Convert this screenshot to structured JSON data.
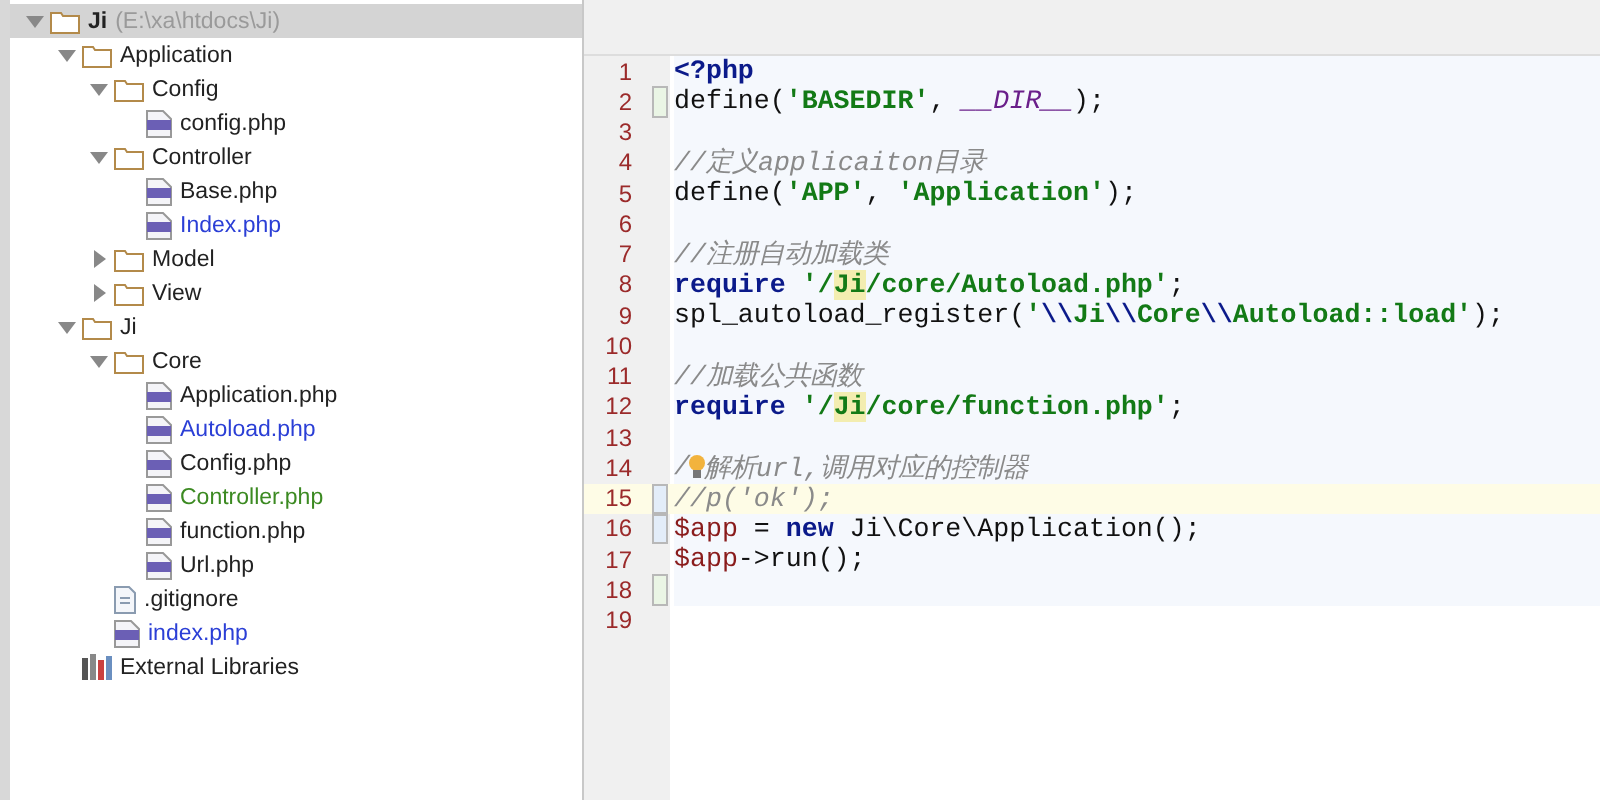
{
  "project_tree": {
    "root": {
      "name": "Ji",
      "path": "(E:\\xa\\htdocs\\Ji)",
      "selected": true,
      "expanded": true
    },
    "items": [
      {
        "kind": "folder",
        "name": "Application",
        "expanded": true,
        "children": [
          {
            "kind": "folder",
            "name": "Config",
            "expanded": true,
            "children": [
              {
                "kind": "php",
                "name": "config.php"
              }
            ]
          },
          {
            "kind": "folder",
            "name": "Controller",
            "expanded": true,
            "children": [
              {
                "kind": "php",
                "name": "Base.php"
              },
              {
                "kind": "php",
                "name": "Index.php",
                "color": "#2b3fd6"
              }
            ]
          },
          {
            "kind": "folder",
            "name": "Model",
            "expanded": false
          },
          {
            "kind": "folder",
            "name": "View",
            "expanded": false
          }
        ]
      },
      {
        "kind": "folder",
        "name": "Ji",
        "expanded": true,
        "children": [
          {
            "kind": "folder",
            "name": "Core",
            "expanded": true,
            "children": [
              {
                "kind": "php",
                "name": "Application.php"
              },
              {
                "kind": "php",
                "name": "Autoload.php",
                "color": "#2b3fd6"
              },
              {
                "kind": "php",
                "name": "Config.php"
              },
              {
                "kind": "php",
                "name": "Controller.php",
                "color": "#3c8a22"
              },
              {
                "kind": "php",
                "name": "function.php"
              },
              {
                "kind": "php",
                "name": "Url.php"
              }
            ]
          },
          {
            "kind": "text",
            "name": ".gitignore"
          },
          {
            "kind": "php",
            "name": "index.php",
            "color": "#2b3fd6"
          }
        ]
      },
      {
        "kind": "library",
        "name": "External Libraries"
      }
    ]
  },
  "editor": {
    "lines": [
      {
        "number": "1",
        "tokens": [
          {
            "kind": "keyword",
            "text": "<?php"
          }
        ]
      },
      {
        "number": "2",
        "kind": "added",
        "tokens": [
          {
            "kind": "plain",
            "text": "define("
          },
          {
            "kind": "string",
            "text": "'BASEDIR'"
          },
          {
            "kind": "plain",
            "text": ", "
          },
          {
            "kind": "constant",
            "text": "__DIR__"
          },
          {
            "kind": "plain",
            "text": ");"
          }
        ]
      },
      {
        "number": "3"
      },
      {
        "number": "4",
        "tokens": [
          {
            "kind": "comment",
            "text": "//定义applicaiton目录"
          }
        ]
      },
      {
        "number": "5",
        "tokens": [
          {
            "kind": "plain",
            "text": "define("
          },
          {
            "kind": "string",
            "text": "'APP'"
          },
          {
            "kind": "plain",
            "text": ", "
          },
          {
            "kind": "string",
            "text": "'Application'"
          },
          {
            "kind": "plain",
            "text": ");"
          }
        ]
      },
      {
        "number": "6"
      },
      {
        "number": "7",
        "tokens": [
          {
            "kind": "comment",
            "text": "//注册自动加载类"
          }
        ]
      },
      {
        "number": "8",
        "tokens": [
          {
            "kind": "keyword",
            "text": "require "
          },
          {
            "kind": "string",
            "text": "'/"
          },
          {
            "kind": "highlight",
            "text": "Ji"
          },
          {
            "kind": "string",
            "text": "/core/Autoload.php'"
          },
          {
            "kind": "plain",
            "text": ";"
          }
        ]
      },
      {
        "number": "9",
        "tokens": [
          {
            "kind": "plain",
            "text": "spl_autoload_register("
          },
          {
            "kind": "string",
            "text": "'"
          },
          {
            "kind": "escape",
            "text": "\\\\"
          },
          {
            "kind": "string",
            "text": "Ji"
          },
          {
            "kind": "escape",
            "text": "\\\\"
          },
          {
            "kind": "string",
            "text": "Core"
          },
          {
            "kind": "escape",
            "text": "\\\\"
          },
          {
            "kind": "string",
            "text": "Autoload::load'"
          },
          {
            "kind": "plain",
            "text": ");"
          }
        ]
      },
      {
        "number": "10"
      },
      {
        "number": "11",
        "tokens": [
          {
            "kind": "comment",
            "text": "//加载公共函数"
          }
        ]
      },
      {
        "number": "12",
        "tokens": [
          {
            "kind": "keyword",
            "text": "require "
          },
          {
            "kind": "string",
            "text": "'/"
          },
          {
            "kind": "highlight",
            "text": "Ji"
          },
          {
            "kind": "string",
            "text": "/core/function.php'"
          },
          {
            "kind": "plain",
            "text": ";"
          }
        ]
      },
      {
        "number": "13"
      },
      {
        "number": "14",
        "bulb": true,
        "tokens": [
          {
            "kind": "comment",
            "text": "/"
          },
          {
            "kind": "comment",
            "text": "解析url,调用对应的控制器"
          }
        ]
      },
      {
        "number": "15",
        "current": true,
        "kind": "modified",
        "tokens": [
          {
            "kind": "comment",
            "text": "//p('ok');"
          }
        ]
      },
      {
        "number": "16",
        "kind": "modified",
        "tokens": [
          {
            "kind": "variable",
            "text": "$app"
          },
          {
            "kind": "plain",
            "text": " = "
          },
          {
            "kind": "keyword",
            "text": "new"
          },
          {
            "kind": "plain",
            "text": " Ji\\Core\\Application();"
          }
        ]
      },
      {
        "number": "17",
        "tokens": [
          {
            "kind": "variable",
            "text": "$app"
          },
          {
            "kind": "plain",
            "text": "->run();"
          }
        ]
      },
      {
        "number": "18",
        "kind": "added"
      },
      {
        "number": "19",
        "after_end": true
      }
    ]
  }
}
